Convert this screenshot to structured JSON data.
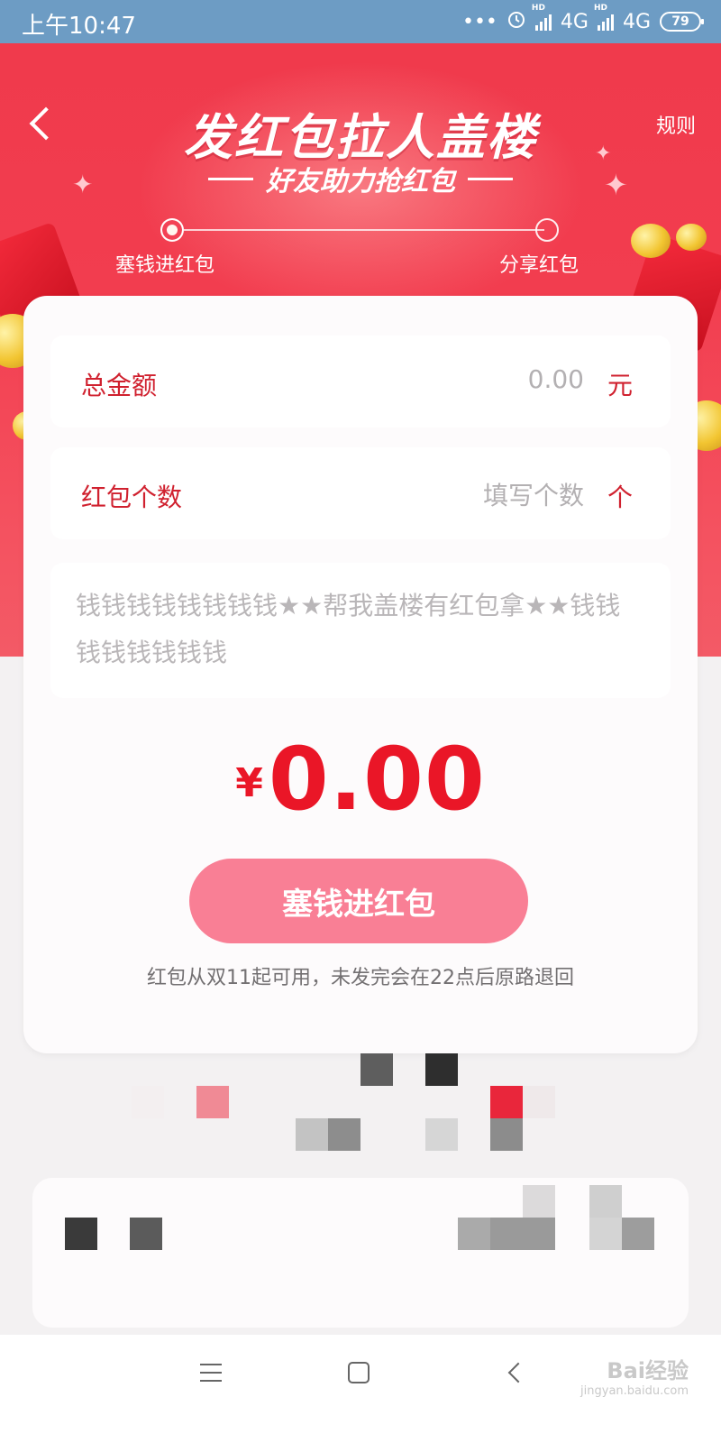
{
  "status_bar": {
    "time": "上午10:47",
    "dots": "•••",
    "network_1": "4G",
    "network_2": "4G",
    "battery": "79"
  },
  "header": {
    "title": "发红包拉人盖楼",
    "subtitle": "好友助力抢红包",
    "rules_label": "规则",
    "steps": [
      "塞钱进红包",
      "分享红包"
    ]
  },
  "form": {
    "total_amount": {
      "label": "总金额",
      "value": "0.00",
      "unit": "元"
    },
    "count": {
      "label": "红包个数",
      "placeholder": "填写个数",
      "unit": "个"
    },
    "message": "钱钱钱钱钱钱钱钱★★帮我盖楼有红包拿★★钱钱钱钱钱钱钱钱"
  },
  "summary": {
    "currency": "¥",
    "amount": "0.00",
    "cta_label": "塞钱进红包",
    "note": "红包从双11起可用，未发完会在22点后原路退回"
  },
  "watermark": {
    "brand": "Bai经验",
    "url": "jingyan.baidu.com"
  },
  "colors": {
    "header_red": "#f23d4f",
    "accent_red": "#ea1627",
    "label_red": "#d0212f",
    "cta_pink": "#f97f95",
    "status_bar": "#6d9cc4"
  }
}
